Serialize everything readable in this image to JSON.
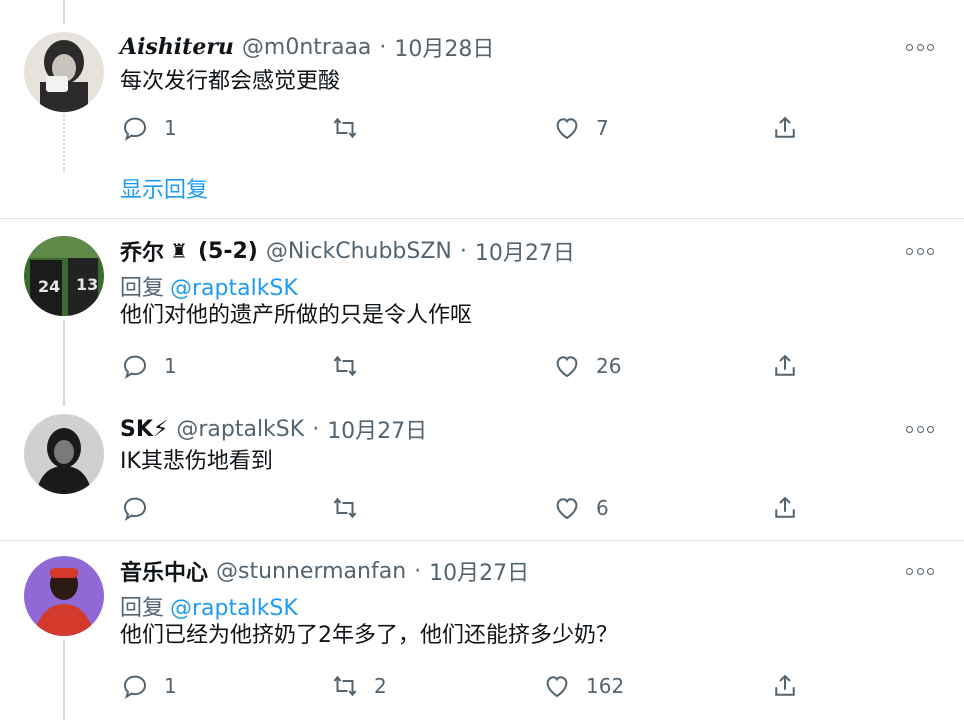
{
  "tweets": [
    {
      "display_name": "Aishiteru",
      "badge": "",
      "handle": "@m0ntraaa",
      "date": "10月28日",
      "reply_prefix": "",
      "reply_mention": "",
      "text": "每次发行都会感觉更酸",
      "replies": "1",
      "retweets": "",
      "likes": "7",
      "avatar_colors": [
        "#2b2b2b",
        "#c9c3bd",
        "#e8e2dc"
      ]
    },
    {
      "display_name": "乔尔",
      "badge": "(5-2)",
      "handle": "@NickChubbSZN",
      "date": "10月27日",
      "reply_prefix": "回复",
      "reply_mention": "@raptalkSK",
      "text": "他们对他的遗产所做的只是令人作呕",
      "replies": "1",
      "retweets": "",
      "likes": "26",
      "avatar_colors": [
        "#3c6a2e",
        "#1b1b1b",
        "#d8d8d8"
      ]
    },
    {
      "display_name": "SK⚡",
      "badge": "",
      "handle": "@raptalkSK",
      "date": "10月27日",
      "reply_prefix": "",
      "reply_mention": "",
      "text": "IK其悲伤地看到",
      "replies": "",
      "retweets": "",
      "likes": "6",
      "avatar_colors": [
        "#1a1a1a",
        "#7a7a7a",
        "#e5e5e5"
      ]
    },
    {
      "display_name": "音乐中心",
      "badge": "",
      "handle": "@stunnermanfan",
      "date": "10月27日",
      "reply_prefix": "回复",
      "reply_mention": "@raptalkSK",
      "text": "他们已经为他挤奶了2年多了，他们还能挤多少奶？",
      "replies": "1",
      "retweets": "2",
      "likes": "162",
      "avatar_colors": [
        "#8f6ad6",
        "#d33a2c",
        "#2a1a12"
      ]
    }
  ],
  "show_replies_label": "显示回复",
  "colors": {
    "accent": "#1d9bf0",
    "secondary_text": "#536471",
    "divider": "#dfe3e6"
  },
  "icons": {
    "reply": "reply-icon",
    "retweet": "retweet-icon",
    "like": "heart-icon",
    "share": "share-icon",
    "more": "more-icon"
  }
}
